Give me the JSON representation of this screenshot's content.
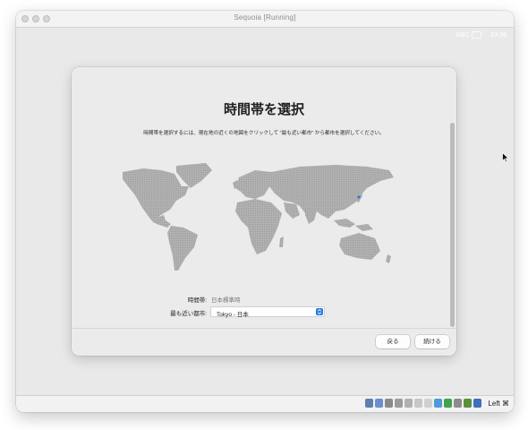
{
  "window": {
    "title": "Sequoia [Running]"
  },
  "vm_menubar": {
    "input_source": "ABC",
    "time": "23:36"
  },
  "dialog": {
    "title": "時間帯を選択",
    "description": "時間帯を選択するには、現在地の近くの地図をクリックして \"最も近い都市\" から都市を選択してください。",
    "timezone_label": "時間帯:",
    "timezone_value": "日本標準時",
    "nearest_city_label": "最も近い都市:",
    "nearest_city_value": "Tokyo - 日本",
    "back_button": "戻る",
    "continue_button": "続ける"
  },
  "statusbar": {
    "host_key": "Left ⌘",
    "icons": [
      "hard-disk-icon",
      "optical-disk-icon",
      "audio-icon",
      "network-icon",
      "usb-icon",
      "shared-folder-icon",
      "display-icon",
      "video-capture-icon",
      "recording-icon",
      "network-activity-icon",
      "cpu-icon",
      "mouse-integration-icon"
    ]
  },
  "colors": {
    "map_land": "#a9a9a9",
    "location_pin": "#2a7ae2",
    "dialog_bg": "#ebebeb",
    "accent": "#2a7ae2"
  }
}
